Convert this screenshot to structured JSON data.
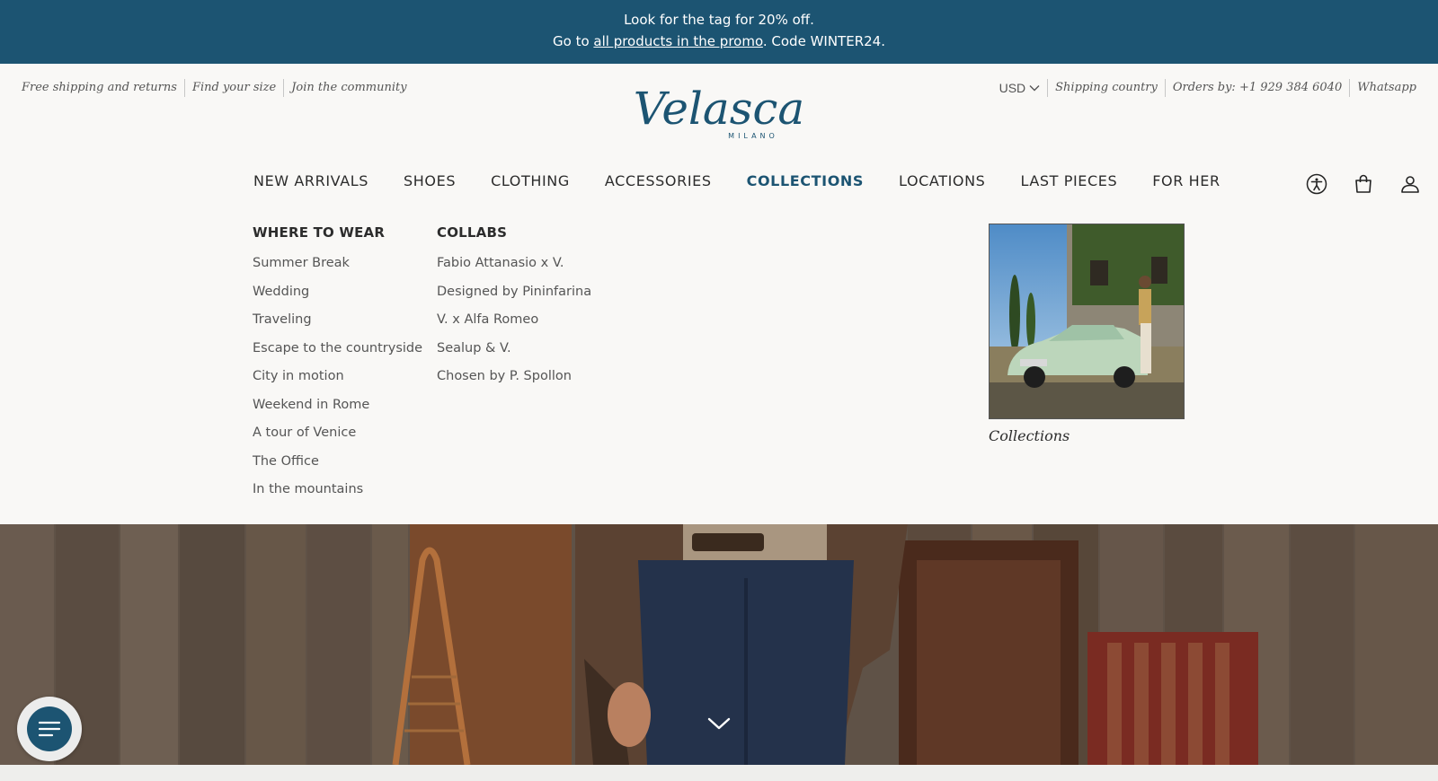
{
  "promo": {
    "line1": "Look for the tag for 20% off.",
    "line2_prefix": "Go to ",
    "line2_link": "all products in the promo",
    "line2_suffix": ". Code WINTER24."
  },
  "utility_left": [
    "Free shipping and returns",
    "Find your size",
    "Join the community"
  ],
  "utility_right": {
    "currency": "USD",
    "shipping": "Shipping country",
    "orders": "Orders by: +1 929 384 6040",
    "whatsapp": "Whatsapp"
  },
  "logo": {
    "brand": "Velasca",
    "sub": "MILANO"
  },
  "nav": [
    "NEW ARRIVALS",
    "SHOES",
    "CLOTHING",
    "ACCESSORIES",
    "COLLECTIONS",
    "LOCATIONS",
    "LAST PIECES",
    "FOR HER"
  ],
  "nav_active": "COLLECTIONS",
  "icons": [
    "accessibility-icon",
    "shopping-bag-icon",
    "account-icon"
  ],
  "mega_menu": {
    "where_to_wear": {
      "heading": "WHERE TO WEAR",
      "items": [
        "Summer Break",
        "Wedding",
        "Traveling",
        "Escape to the countryside",
        "City in motion",
        "Weekend in Rome",
        "A tour of Venice",
        "The Office",
        "In the mountains"
      ]
    },
    "collabs": {
      "heading": "COLLABS",
      "items": [
        "Fabio Attanasio x V.",
        "Designed by Pininfarina",
        "V. x Alfa Romeo",
        "Sealup & V.",
        "Chosen by P. Spollon"
      ]
    },
    "promo_caption": "Collections"
  },
  "colors": {
    "brand": "#1c5472",
    "background": "#f9f8f6",
    "text": "#2c2c2c"
  }
}
